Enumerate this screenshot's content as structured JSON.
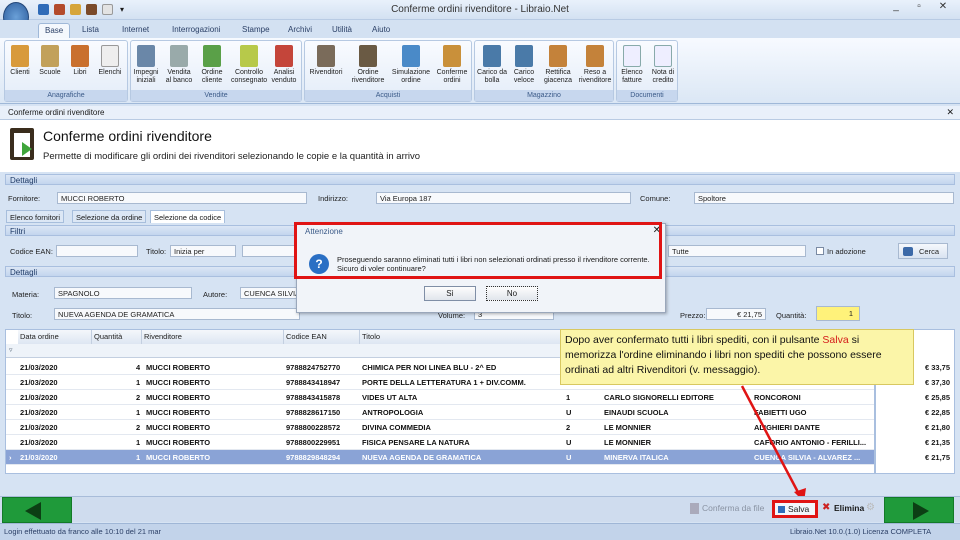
{
  "window": {
    "title": "Conferme ordini rivenditore - Libraio.Net"
  },
  "ribbon_tabs": [
    "Base",
    "Lista",
    "Internet",
    "Interrogazioni",
    "Stampe",
    "Archivi",
    "Utilità",
    "Aiuto"
  ],
  "ribbon_groups": [
    {
      "label": "Anagrafiche",
      "buttons": [
        "Clienti",
        "Scuole",
        "Libri",
        "Elenchi"
      ]
    },
    {
      "label": "Vendite",
      "buttons": [
        "Impegni iniziali",
        "Vendita al banco",
        "Ordine cliente",
        "Controllo consegnato",
        "Analisi venduto"
      ]
    },
    {
      "label": "Acquisti",
      "buttons": [
        "Rivenditori",
        "Ordine rivenditore",
        "Simulazione ordine",
        "Conferme ordini"
      ]
    },
    {
      "label": "Magazzino",
      "buttons": [
        "Carico da bolla",
        "Carico veloce",
        "Rettifica giacenza",
        "Reso a rivenditore"
      ]
    },
    {
      "label": "Documenti",
      "buttons": [
        "Elenco fatture",
        "Nota di credito"
      ]
    }
  ],
  "document_tab": "Conferme ordini rivenditore",
  "header": {
    "title": "Conferme ordini rivenditore",
    "subtitle": "Permette di modificare gli ordini dei rivenditori selezionando le copie e la quantità in arrivo"
  },
  "details": {
    "section_label": "Dettagli",
    "fornitore_label": "Fornitore:",
    "fornitore_value": "MUCCI ROBERTO",
    "indirizzo_label": "Indirizzo:",
    "indirizzo_value": "Via Europa 187",
    "comune_label": "Comune:",
    "comune_value": "Spoltore"
  },
  "subtabs": [
    "Elenco fornitori",
    "Selezione da ordine",
    "Selezione da codice"
  ],
  "filters": {
    "section_label": "Filtri",
    "ean_label": "Codice EAN:",
    "titolo_label": "Titolo:",
    "titolo_mode": "Inizia per",
    "select_value": "Tutte",
    "adozione_label": "In adozione",
    "search_button": "Cerca"
  },
  "dettagli": {
    "section_label": "Dettagli",
    "materia_label": "Materia:",
    "materia_value": "SPAGNOLO",
    "autore_label": "Autore:",
    "autore_value": "CUENCA SILVIA",
    "titolo_label": "Titolo:",
    "titolo_value": "NUEVA AGENDA DE GRAMATICA",
    "volume_label": "Volume:",
    "volume_value": "3",
    "prezzo_label": "Prezzo:",
    "prezzo_value": "€ 21,75",
    "quantita_label": "Quantità:",
    "quantita_value": "1"
  },
  "grid": {
    "columns": [
      "Data ordine",
      "Quantità",
      "Rivenditore",
      "Codice EAN",
      "Titolo"
    ],
    "rows": [
      {
        "data": "21/03/2020",
        "qta": "4",
        "riv": "MUCCI ROBERTO",
        "ean": "9788824752770",
        "titolo": "CHIMICA PER NOI LINEA BLU - 2^ ED",
        "vol": "",
        "editore": "",
        "autore": "",
        "prezzo": "€ 33,75"
      },
      {
        "data": "21/03/2020",
        "qta": "1",
        "riv": "MUCCI ROBERTO",
        "ean": "9788843418947",
        "titolo": "PORTE DELLA LETTERATURA 1 + DIV.COMM.",
        "vol": "",
        "editore": "CARLO SIGNORELLI EDITORE",
        "autore": "",
        "prezzo": "€ 37,30"
      },
      {
        "data": "21/03/2020",
        "qta": "2",
        "riv": "MUCCI ROBERTO",
        "ean": "9788843415878",
        "titolo": "VIDES UT ALTA",
        "vol": "1",
        "editore": "CARLO SIGNORELLI EDITORE",
        "autore": "RONCORONI",
        "prezzo": "€ 25,85"
      },
      {
        "data": "21/03/2020",
        "qta": "1",
        "riv": "MUCCI ROBERTO",
        "ean": "9788828617150",
        "titolo": "ANTROPOLOGIA",
        "vol": "U",
        "editore": "EINAUDI SCUOLA",
        "autore": "FABIETTI UGO",
        "prezzo": "€ 22,85"
      },
      {
        "data": "21/03/2020",
        "qta": "2",
        "riv": "MUCCI ROBERTO",
        "ean": "9788800228572",
        "titolo": "DIVINA COMMEDIA",
        "vol": "2",
        "editore": "LE MONNIER",
        "autore": "ALIGHIERI DANTE",
        "prezzo": "€ 21,80"
      },
      {
        "data": "21/03/2020",
        "qta": "1",
        "riv": "MUCCI ROBERTO",
        "ean": "9788800229951",
        "titolo": "FISICA PENSARE LA NATURA",
        "vol": "U",
        "editore": "LE MONNIER",
        "autore": "CAFORIO ANTONIO - FERILLI...",
        "prezzo": "€ 21,35"
      },
      {
        "data": "21/03/2020",
        "qta": "1",
        "riv": "MUCCI ROBERTO",
        "ean": "9788829848294",
        "titolo": "NUEVA AGENDA DE GRAMATICA",
        "vol": "U",
        "editore": "MINERVA ITALICA",
        "autore": "CUENCA SILVIA - ALVAREZ ...",
        "prezzo": "€ 21,75"
      }
    ]
  },
  "dialog": {
    "title": "Attenzione",
    "message": "Proseguendo saranno eliminati tutti i libri non selezionati ordinati presso il rivenditore corrente. Sicuro di voler continuare?",
    "yes": "Sì",
    "no": "No"
  },
  "callout": {
    "part1": "Dopo aver confermato tutti i libri spediti, con il pulsante ",
    "highlight": "Salva",
    "part2": " si memorizza l'ordine eliminando i libri non spediti che possono essere ordinati ad altri Rivenditori (v. messaggio)."
  },
  "bottom": {
    "conferma": "Conferma da file",
    "salva": "Salva",
    "elimina": "Elimina"
  },
  "status": {
    "login": "Login effettuato da franco alle 10:10 del 21 mar",
    "version": "Libraio.Net 10.0.(1.0) Licenza COMPLETA"
  },
  "colors": {
    "accent_red": "#e01414",
    "nav_green": "#1f9a3a",
    "selected_row": "#8aa3d6",
    "callout_bg": "#fbf5a8"
  }
}
